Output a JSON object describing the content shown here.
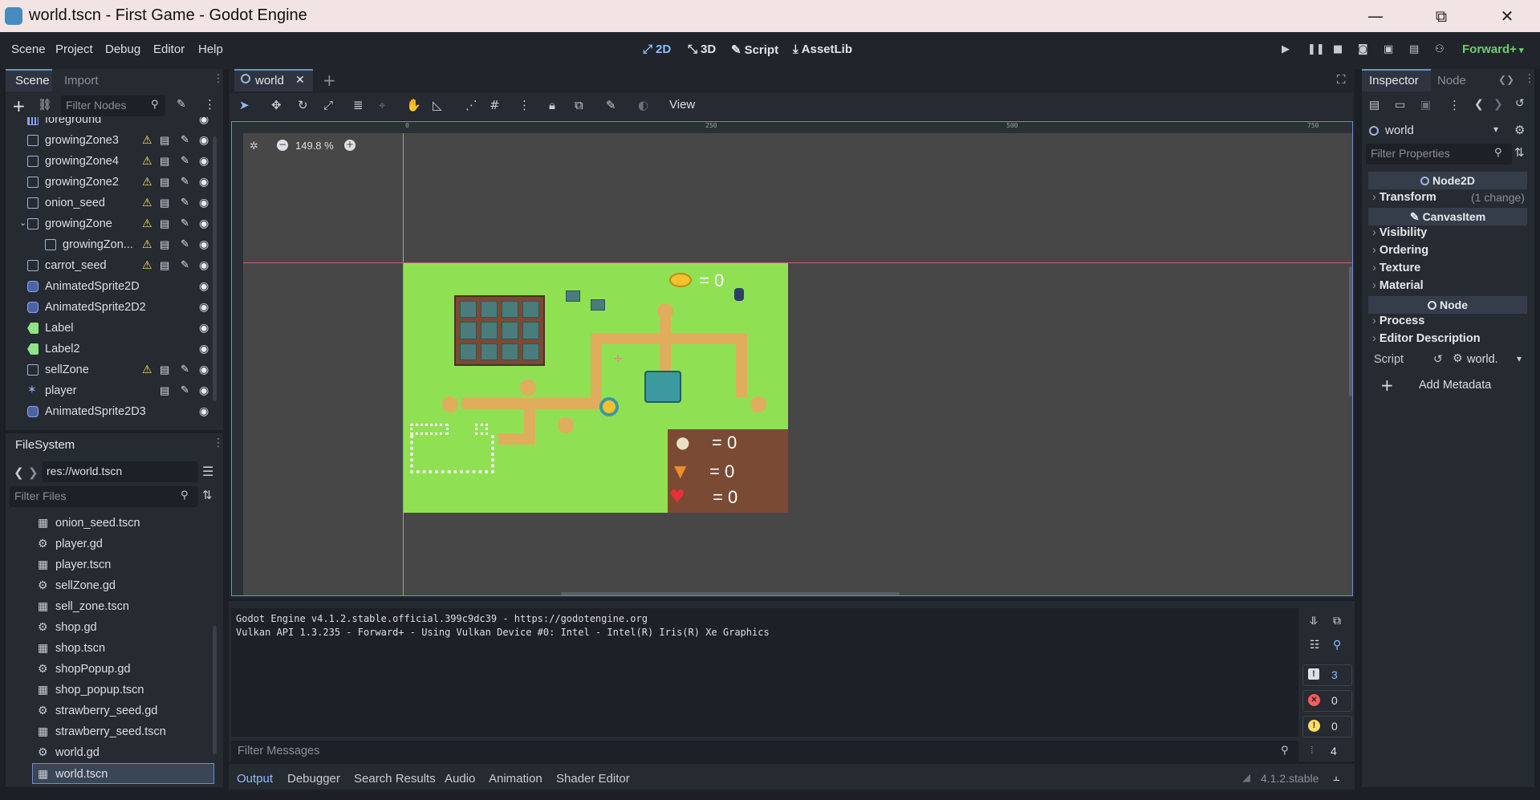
{
  "window": {
    "title": "world.tscn - First Game - Godot Engine",
    "minimize": "—",
    "maximize": "⧉",
    "close": "✕"
  },
  "menu": {
    "items": [
      "Scene",
      "Project",
      "Debug",
      "Editor",
      "Help"
    ]
  },
  "workspaces": {
    "2d": "2D",
    "3d": "3D",
    "script": "Script",
    "assetlib": "AssetLib"
  },
  "renderer": "Forward+",
  "scene_dock": {
    "tabs": [
      "Scene",
      "Import"
    ],
    "filter_placeholder": "Filter Nodes",
    "nodes": [
      {
        "name": "foreground",
        "icon": "tilemap-icon",
        "warn": false,
        "r1": false,
        "r2": false
      },
      {
        "name": "growingZone3",
        "icon": "area-icon",
        "warn": true,
        "r1": true,
        "r2": true
      },
      {
        "name": "growingZone4",
        "icon": "area-icon",
        "warn": true,
        "r1": true,
        "r2": true
      },
      {
        "name": "growingZone2",
        "icon": "area-icon",
        "warn": true,
        "r1": true,
        "r2": true
      },
      {
        "name": "onion_seed",
        "icon": "area-icon",
        "warn": true,
        "r1": true,
        "r2": true
      },
      {
        "name": "growingZone",
        "icon": "area-icon",
        "warn": true,
        "r1": true,
        "r2": true
      },
      {
        "name": "growingZon...",
        "icon": "area-icon",
        "warn": true,
        "r1": true,
        "r2": true
      },
      {
        "name": "carrot_seed",
        "icon": "area-icon",
        "warn": true,
        "r1": true,
        "r2": true
      },
      {
        "name": "AnimatedSprite2D",
        "icon": "sprite-icon",
        "warn": false,
        "r1": false,
        "r2": false
      },
      {
        "name": "AnimatedSprite2D2",
        "icon": "sprite-icon",
        "warn": false,
        "r1": false,
        "r2": false
      },
      {
        "name": "Label",
        "icon": "label-icon",
        "warn": false,
        "r1": false,
        "r2": false
      },
      {
        "name": "Label2",
        "icon": "label-icon",
        "warn": false,
        "r1": false,
        "r2": false
      },
      {
        "name": "sellZone",
        "icon": "area-icon",
        "warn": true,
        "r1": true,
        "r2": true
      },
      {
        "name": "player",
        "icon": "player-icon",
        "warn": false,
        "r1": true,
        "r2": true
      },
      {
        "name": "AnimatedSprite2D3",
        "icon": "sprite-icon",
        "warn": false,
        "r1": false,
        "r2": false
      }
    ]
  },
  "filesystem_dock": {
    "title": "FileSystem",
    "path": "res://world.tscn",
    "filter_placeholder": "Filter Files",
    "files": [
      {
        "name": "onion_seed.tscn",
        "icon": "scene-icon"
      },
      {
        "name": "player.gd",
        "icon": "gear-icon"
      },
      {
        "name": "player.tscn",
        "icon": "scene-icon"
      },
      {
        "name": "sellZone.gd",
        "icon": "gear-icon"
      },
      {
        "name": "sell_zone.tscn",
        "icon": "scene-icon"
      },
      {
        "name": "shop.gd",
        "icon": "gear-icon"
      },
      {
        "name": "shop.tscn",
        "icon": "scene-icon"
      },
      {
        "name": "shopPopup.gd",
        "icon": "gear-icon"
      },
      {
        "name": "shop_popup.tscn",
        "icon": "scene-icon"
      },
      {
        "name": "strawberry_seed.gd",
        "icon": "gear-icon"
      },
      {
        "name": "strawberry_seed.tscn",
        "icon": "scene-icon"
      },
      {
        "name": "world.gd",
        "icon": "gear-icon"
      },
      {
        "name": "world.tscn",
        "icon": "scene-icon",
        "selected": true
      }
    ]
  },
  "editor": {
    "tab_name": "world",
    "view_menu": "View",
    "zoom": "149.8 %",
    "ruler_labels": [
      "0",
      "250",
      "500",
      "750"
    ],
    "game_counters": {
      "coins": "= 0",
      "onion": "= 0",
      "carrot": "= 0",
      "strawberry": "= 0"
    }
  },
  "output": {
    "lines": [
      "Godot Engine v4.1.2.stable.official.399c9dc39 - https://godotengine.org",
      "Vulkan API 1.3.235 - Forward+ - Using Vulkan Device #0: Intel - Intel(R) Iris(R) Xe Graphics"
    ],
    "filter_placeholder": "Filter Messages",
    "counts": {
      "messages": "3",
      "errors": "0",
      "warnings": "0",
      "editor": "4"
    }
  },
  "bottom_tabs": [
    "Output",
    "Debugger",
    "Search Results",
    "Audio",
    "Animation",
    "Shader Editor"
  ],
  "version": "4.1.2.stable",
  "inspector": {
    "tabs": [
      "Inspector",
      "Node"
    ],
    "object": "world",
    "filter_placeholder": "Filter Properties",
    "node2d": "Node2D",
    "transform": "Transform",
    "transform_note": "(1 change)",
    "canvas_item": "CanvasItem",
    "canvas_groups": [
      "Visibility",
      "Ordering",
      "Texture",
      "Material"
    ],
    "node": "Node",
    "node_groups": [
      "Process",
      "Editor Description"
    ],
    "script_label": "Script",
    "script_value": "world.",
    "add_metadata": "Add Metadata"
  }
}
